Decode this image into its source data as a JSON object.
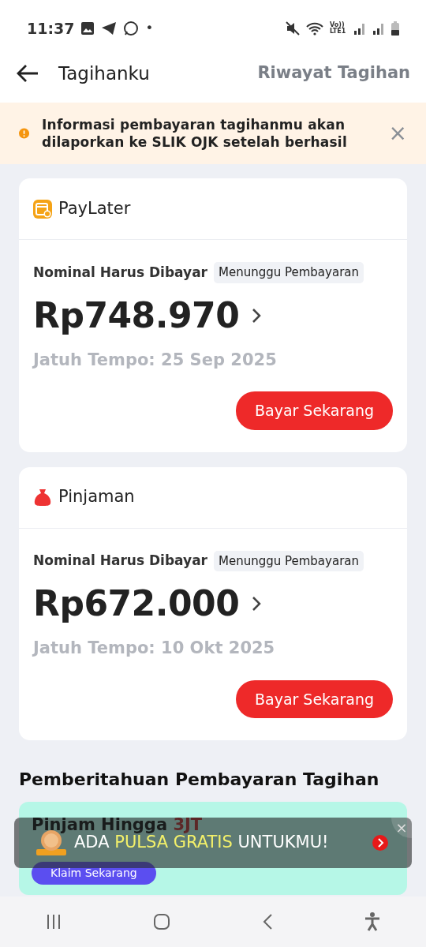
{
  "status_bar": {
    "time": "11:37",
    "dot": "•",
    "network": "Vo)) LTE1"
  },
  "header": {
    "title": "Tagihanku",
    "action": "Riwayat Tagihan"
  },
  "alert": {
    "text": "Informasi pembayaran tagihanmu akan dilaporkan ke SLIK OJK setelah berhasil",
    "close": "×"
  },
  "bills": [
    {
      "kind": "paylater",
      "name": "PayLater",
      "label": "Nominal Harus Dibayar",
      "status": "Menunggu Pembayaran",
      "amount": "Rp748.970",
      "due": "Jatuh Tempo: 25 Sep 2025",
      "button": "Bayar Sekarang"
    },
    {
      "kind": "loan",
      "name": "Pinjaman",
      "label": "Nominal Harus Dibayar",
      "status": "Menunggu Pembayaran",
      "amount": "Rp672.000",
      "due": "Jatuh Tempo: 10 Okt 2025",
      "button": "Bayar Sekarang"
    }
  ],
  "section_title": "Pemberitahuan Pembayaran Tagihan",
  "promo": {
    "title": "Pinjam Hingga **3JT**",
    "button": "Klaim Sekarang"
  },
  "toast": {
    "parts": [
      "ADA ",
      "PULSA GRATIS",
      " UNTUKMU!"
    ],
    "close": "×"
  }
}
